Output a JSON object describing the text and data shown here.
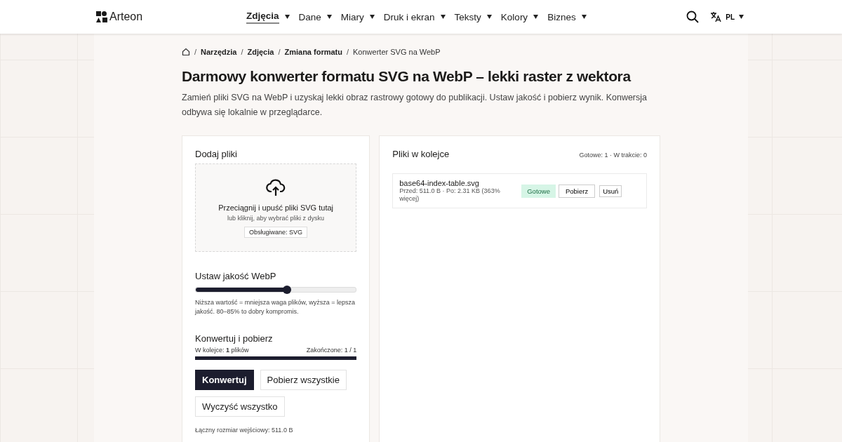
{
  "header": {
    "logo": "Arteon",
    "nav": [
      {
        "label": "Zdjęcia",
        "selected": true
      },
      {
        "label": "Dane",
        "selected": false
      },
      {
        "label": "Miary",
        "selected": false
      },
      {
        "label": "Druk i ekran",
        "selected": false
      },
      {
        "label": "Teksty",
        "selected": false
      },
      {
        "label": "Kolory",
        "selected": false
      },
      {
        "label": "Biznes",
        "selected": false
      }
    ],
    "language": "PL"
  },
  "breadcrumb": {
    "separator": "/",
    "links": [
      "Narzędzia",
      "Zdjęcia",
      "Zmiana formatu"
    ],
    "current": "Konwerter SVG na WebP"
  },
  "title": "Darmowy konwerter formatu SVG na WebP – lekki raster z wektora",
  "intro": "Zamień pliki SVG na WebP i uzyskaj lekki obraz rastrowy gotowy do publikacji. Ustaw jakość i pobierz wynik. Konwersja odbywa się lokalnie w przeglądarce.",
  "add_files": {
    "heading": "Dodaj pliki",
    "drop_title": "Przeciągnij i upuść pliki SVG tutaj",
    "drop_hint": "lub kliknij, aby wybrać pliki z dysku",
    "supported": "Obsługiwane: SVG"
  },
  "quality": {
    "heading": "Ustaw jakość WebP",
    "level": 0.57,
    "hint": "Niższa wartość = mniejsza waga plików, wyższa = lepsza jakość. 80–85% to dobry kompromis."
  },
  "convert": {
    "heading": "Konwertuj i pobierz",
    "queue_label": "W kolejce: ",
    "queue_count": "1",
    "queue_unit": " plików",
    "done": "Zakończone: 1 / 1",
    "level": 1,
    "buttons": [
      {
        "label": "Konwertuj",
        "kind": "primary"
      },
      {
        "label": "Pobierz wszystkie",
        "kind": "secondary"
      },
      {
        "label": "Wyczyść wszystko",
        "kind": "secondary"
      }
    ],
    "total": "Łączny rozmiar wejściowy: 511.0 B"
  },
  "queue": {
    "heading": "Pliki w kolejce",
    "summary": "Gotowe: 1 · W trakcie: 0",
    "files": [
      {
        "name": "base64-index-table.svg",
        "details": "Przed: 511.0 B · Po: 2.31 KB (363% więcej)",
        "status": "Gotowe",
        "download": "Pobierz",
        "remove": "Usuń"
      }
    ]
  }
}
